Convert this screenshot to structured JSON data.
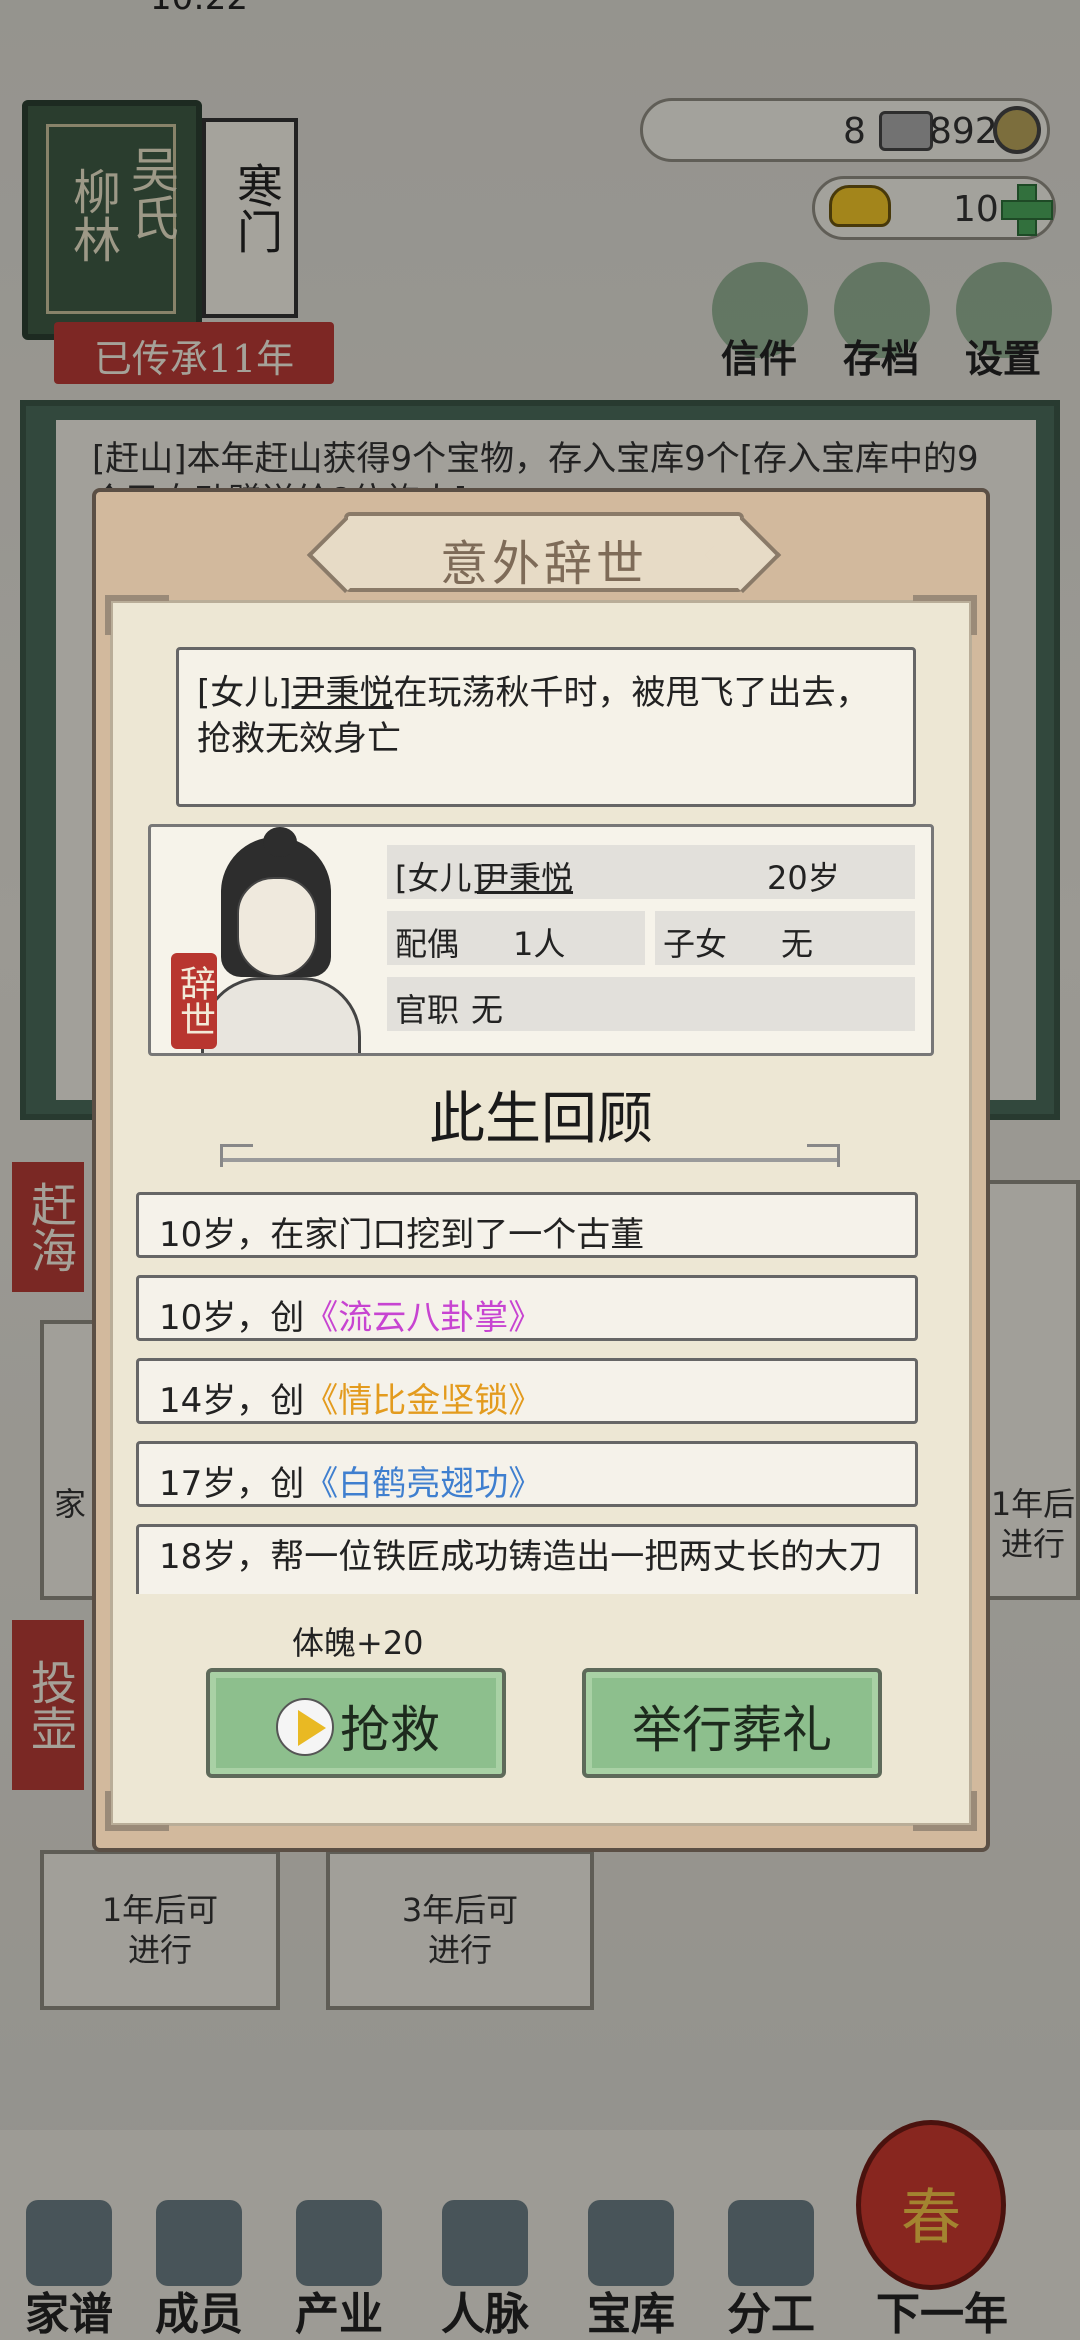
{
  "status": {
    "time": "10:22"
  },
  "clan": {
    "surname": "吴氏",
    "place": "柳林",
    "house_type": "寒门",
    "inherited": "已传承11年"
  },
  "currency": {
    "silver_left": "8",
    "silver_right": "892",
    "gold": "10"
  },
  "top_menu": [
    {
      "label": "信件",
      "icon": "letter-icon"
    },
    {
      "label": "存档",
      "icon": "save-icon"
    },
    {
      "label": "设置",
      "icon": "gear-icon"
    }
  ],
  "log": {
    "text": "[赶山]本年赶山获得9个宝物，存入宝库9个[存入宝库中的9个已自动赠送给8位族人]"
  },
  "side_activities": {
    "ganhai": {
      "tag": "赶海",
      "card_short": "家",
      "right_card": "1年后\n进行"
    },
    "touhu": {
      "tag": "投壶"
    },
    "bottom_left": "1年后可\n进行",
    "bottom_mid": "3年后可\n进行"
  },
  "dialog": {
    "title": "意外辞世",
    "message_prefix": "[女儿]",
    "message_name": "尹秉悦",
    "message_rest": "在玩荡秋千时，被甩飞了出去，抢救无效身亡",
    "seal": "辞世",
    "person": {
      "relation": "[女儿]",
      "name": "尹秉悦",
      "age": "20岁",
      "spouse_label": "配偶",
      "spouse_value": "1人",
      "children_label": "子女",
      "children_value": "无",
      "office_label": "官职",
      "office_value": "无"
    },
    "review_title": "此生回顾",
    "events": [
      {
        "prefix": "10岁，在家门口挖到了一个古董",
        "skill": ""
      },
      {
        "prefix": "10岁，创",
        "skill": "《流云八卦掌》"
      },
      {
        "prefix": "14岁，创",
        "skill": "《情比金坚锁》"
      },
      {
        "prefix": "17岁，创",
        "skill": "《白鹤亮翅功》"
      },
      {
        "prefix": "18岁，帮一位铁匠成功铸造出一把两丈长的大刀",
        "skill": ""
      }
    ],
    "stat_bonus": "体魄+20",
    "rescue_label": "抢救",
    "funeral_label": "举行葬礼"
  },
  "bottom_nav": [
    {
      "label": "家谱",
      "icon": "genealogy-icon"
    },
    {
      "label": "成员",
      "icon": "member-icon"
    },
    {
      "label": "产业",
      "icon": "industry-icon"
    },
    {
      "label": "人脉",
      "icon": "network-icon"
    },
    {
      "label": "宝库",
      "icon": "treasury-icon"
    },
    {
      "label": "分工",
      "icon": "task-icon"
    },
    {
      "label": "下一年",
      "icon": "lantern-icon"
    }
  ],
  "lantern_text": "春",
  "colors": {
    "accent_red": "#b83a36",
    "button_green": "#8dbf8d",
    "skill_purple": "#c744d1",
    "skill_orange": "#e39b1e",
    "skill_blue": "#3f7fcf"
  }
}
